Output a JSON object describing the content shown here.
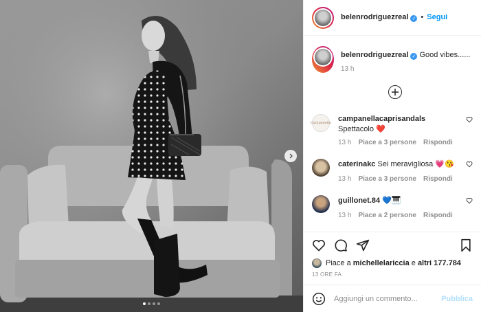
{
  "post": {
    "username": "belenrodriguezreal",
    "dot": "•",
    "follow_label": "Segui",
    "verified_glyph": "✓",
    "caption": "Good vibes......",
    "caption_time": "13 h"
  },
  "comments": [
    {
      "username": "campanellacaprisandals",
      "text": "Spettacolo ❤️",
      "time": "13 h",
      "likes": "Piace a 3 persone",
      "reply": "Rispondi",
      "avatar_logo": "Campanella"
    },
    {
      "username": "caterinakc",
      "text": "Sei meravigliosa 💗😘",
      "time": "13 h",
      "likes": "Piace a 3 persone",
      "reply": "Rispondi"
    },
    {
      "username": "guillonet.84",
      "text": "💙🎹",
      "time": "13 h",
      "likes": "Piace a 2 persone",
      "reply": "Rispondi"
    }
  ],
  "actions": {
    "likes_prefix": "Piace a ",
    "likes_user": "michellelariccia",
    "likes_middle": " e ",
    "likes_others": "altri 177.784",
    "timestamp": "13 ORE FA"
  },
  "composer": {
    "placeholder": "Aggiungi un commento...",
    "publish_label": "Pubblica"
  },
  "carousel": {
    "count": 4,
    "active": 1
  },
  "icons": {
    "like": "heart-icon",
    "comment": "comment-icon",
    "share": "send-icon",
    "save": "bookmark-icon",
    "emoji": "emoji-icon",
    "more": "plus-circle-icon",
    "next": "chevron-right-icon"
  },
  "colors": {
    "link": "#0095f6",
    "muted": "#8e8e8e",
    "publish_disabled": "#b2dffc",
    "heart": "#ed4956"
  }
}
